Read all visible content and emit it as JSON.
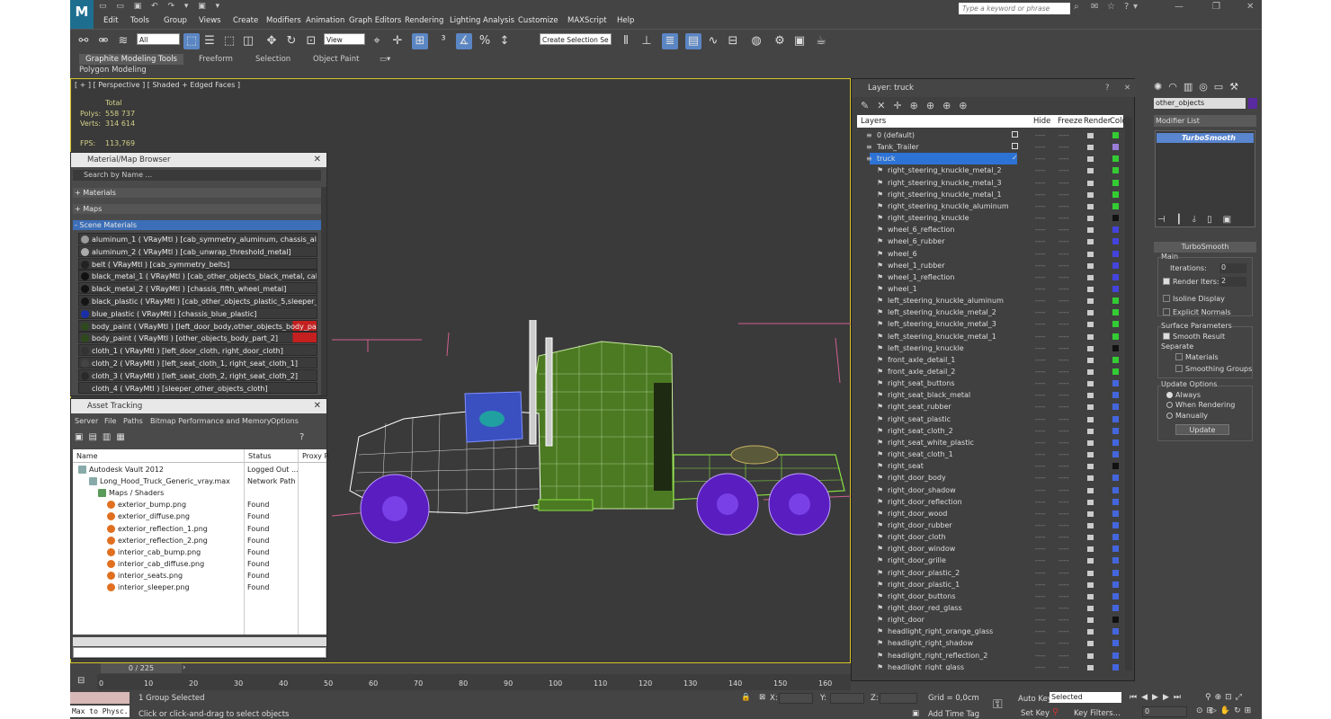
{
  "app": {
    "logo": "M",
    "menus": [
      "Edit",
      "Tools",
      "Group",
      "Views",
      "Create",
      "Modifiers",
      "Animation",
      "Graph Editors",
      "Rendering",
      "Lighting Analysis",
      "Customize",
      "MAXScript",
      "Help"
    ],
    "search_placeholder": "Type a keyword or phrase"
  },
  "toolbar": {
    "filter": "All",
    "refcoord": "View",
    "selset": "Create Selection Se"
  },
  "ribbon": {
    "tabs": [
      "Graphite Modeling Tools",
      "Freeform",
      "Selection",
      "Object Paint"
    ],
    "sub": "Polygon Modeling"
  },
  "viewport": {
    "label": "[ + ] [ Perspective ] [ Shaded + Edged Faces ]",
    "total_label": "Total",
    "polys_label": "Polys:",
    "polys": "558 737",
    "verts_label": "Verts:",
    "verts": "314 614",
    "fps_label": "FPS:",
    "fps": "113,769"
  },
  "material_browser": {
    "title": "Material/Map Browser",
    "search": "Search by Name ...",
    "sections": [
      "+ Materials",
      "+ Maps",
      "- Scene Materials"
    ],
    "items": [
      {
        "label": "aluminum_1  ( VRayMtl ) [cab_symmetry_aluminum, chassis_alumin...",
        "color": "#9a9a9a"
      },
      {
        "label": "aluminum_2  ( VRayMtl ) [cab_unwrap_threshold_metal]",
        "color": "#aaaaaa"
      },
      {
        "label": "belt  ( VRayMtl ) [cab_symmetry_belts]",
        "color": "#222222"
      },
      {
        "label": "black_metal_1  ( VRayMtl ) [cab_other_objects_black_metal, cab_sy...",
        "color": "#111111"
      },
      {
        "label": "black_metal_2  ( VRayMtl ) [chassis_fifth_wheel_metal]",
        "color": "#111111"
      },
      {
        "label": "black_plastic  ( VRayMtl ) [cab_other_objects_plastic_5,sleeper_oth...",
        "color": "#151515"
      },
      {
        "label": "blue_plastic  ( VRayMtl ) [chassis_blue_plastic]",
        "color": "#1a2ea8"
      },
      {
        "label": "body_paint  ( VRayMtl ) [left_door_body,other_objects_body_part_1...",
        "color": "#2e4a1c"
      },
      {
        "label": "body_paint  ( VRayMtl ) [other_objects_body_part_2]",
        "color": "#2e4a1c"
      },
      {
        "label": "cloth_1  ( VRayMtl ) [left_door_cloth, right_door_cloth]",
        "color": "#333333"
      },
      {
        "label": "cloth_2  ( VRayMtl ) [left_seat_cloth_1, right_seat_cloth_1]",
        "color": "#444444"
      },
      {
        "label": "cloth_3  ( VRayMtl ) [left_seat_cloth_2, right_seat_cloth_2]",
        "color": "#2a2a2a"
      },
      {
        "label": "cloth_4  ( VRayMtl ) [sleeper_other_objects_cloth]",
        "color": "#3a3a3a"
      }
    ]
  },
  "asset_tracking": {
    "title": "Asset Tracking",
    "menus": [
      "Server",
      "File",
      "Paths",
      "Bitmap Performance and Memory",
      "Options"
    ],
    "headers": [
      "Name",
      "Status",
      "Proxy R"
    ],
    "rows": [
      {
        "name": "Autodesk Vault 2012",
        "status": "Logged Out ..."
      },
      {
        "name": "Long_Hood_Truck_Generic_vray.max",
        "status": "Network Path"
      },
      {
        "name": "Maps / Shaders",
        "status": ""
      },
      {
        "name": "exterior_bump.png",
        "status": "Found"
      },
      {
        "name": "exterior_diffuse.png",
        "status": "Found"
      },
      {
        "name": "exterior_reflection_1.png",
        "status": "Found"
      },
      {
        "name": "exterior_reflection_2.png",
        "status": "Found"
      },
      {
        "name": "interior_cab_bump.png",
        "status": "Found"
      },
      {
        "name": "interior_cab_diffuse.png",
        "status": "Found"
      },
      {
        "name": "interior_seats.png",
        "status": "Found"
      },
      {
        "name": "interior_sleeper.png",
        "status": "Found"
      }
    ]
  },
  "layer_dialog": {
    "title": "Layer: truck",
    "headers": [
      "Layers",
      "Hide",
      "Freeze",
      "Render",
      "Color"
    ],
    "layers": [
      {
        "name": "0 (default)",
        "color": "#33cc33",
        "top": true
      },
      {
        "name": "Tank_Trailer",
        "color": "#9b7dd8",
        "top": true
      },
      {
        "name": "truck",
        "color": "#33cc33",
        "top": true,
        "selected": true
      },
      {
        "name": "right_steering_knuckle_metal_2",
        "color": "#33cc33"
      },
      {
        "name": "right_steering_knuckle_metal_3",
        "color": "#33cc33"
      },
      {
        "name": "right_steering_knuckle_metal_1",
        "color": "#33cc33"
      },
      {
        "name": "right_steering_knuckle_aluminum",
        "color": "#33cc33"
      },
      {
        "name": "right_steering_knuckle",
        "color": "#111111"
      },
      {
        "name": "wheel_6_reflection",
        "color": "#4444dd"
      },
      {
        "name": "wheel_6_rubber",
        "color": "#4444dd"
      },
      {
        "name": "wheel_6",
        "color": "#4444dd"
      },
      {
        "name": "wheel_1_rubber",
        "color": "#4444dd"
      },
      {
        "name": "wheel_1_reflection",
        "color": "#4444dd"
      },
      {
        "name": "wheel_1",
        "color": "#4444dd"
      },
      {
        "name": "left_steering_knuckle_aluminum",
        "color": "#33cc33"
      },
      {
        "name": "left_steering_knuckle_metal_2",
        "color": "#33cc33"
      },
      {
        "name": "left_steering_knuckle_metal_3",
        "color": "#33cc33"
      },
      {
        "name": "left_steering_knuckle_metal_1",
        "color": "#33cc33"
      },
      {
        "name": "left_steering_knuckle",
        "color": "#111111"
      },
      {
        "name": "front_axle_detail_1",
        "color": "#33cc33"
      },
      {
        "name": "front_axle_detail_2",
        "color": "#33cc33"
      },
      {
        "name": "right_seat_buttons",
        "color": "#4466dd"
      },
      {
        "name": "right_seat_black_metal",
        "color": "#4466dd"
      },
      {
        "name": "right_seat_rubber",
        "color": "#4466dd"
      },
      {
        "name": "right_seat_plastic",
        "color": "#4466dd"
      },
      {
        "name": "right_seat_cloth_2",
        "color": "#4466dd"
      },
      {
        "name": "right_seat_white_plastic",
        "color": "#4466dd"
      },
      {
        "name": "right_seat_cloth_1",
        "color": "#4466dd"
      },
      {
        "name": "right_seat",
        "color": "#111111"
      },
      {
        "name": "right_door_body",
        "color": "#4466dd"
      },
      {
        "name": "right_door_shadow",
        "color": "#4466dd"
      },
      {
        "name": "right_door_reflection",
        "color": "#4466dd"
      },
      {
        "name": "right_door_wood",
        "color": "#4466dd"
      },
      {
        "name": "right_door_rubber",
        "color": "#4466dd"
      },
      {
        "name": "right_door_cloth",
        "color": "#4466dd"
      },
      {
        "name": "right_door_window",
        "color": "#4466dd"
      },
      {
        "name": "right_door_grille",
        "color": "#4466dd"
      },
      {
        "name": "right_door_plastic_2",
        "color": "#4466dd"
      },
      {
        "name": "right_door_plastic_1",
        "color": "#4466dd"
      },
      {
        "name": "right_door_buttons",
        "color": "#4466dd"
      },
      {
        "name": "right_door_red_glass",
        "color": "#4466dd"
      },
      {
        "name": "right_door",
        "color": "#111111"
      },
      {
        "name": "headlight_right_orange_glass",
        "color": "#4466dd"
      },
      {
        "name": "headlight_right_shadow",
        "color": "#4466dd"
      },
      {
        "name": "headlight_right_reflection_2",
        "color": "#4466dd"
      },
      {
        "name": "headlight_right_glass",
        "color": "#4466dd"
      }
    ]
  },
  "command_panel": {
    "object_name": "other_objects",
    "modifier_list": "Modifier List",
    "stack_item": "TurboSmooth",
    "rollout": "TurboSmooth",
    "main": "Main",
    "iterations_label": "Iterations:",
    "iterations": "0",
    "render_iters_label": "Render Iters:",
    "render_iters": "2",
    "isoline": "Isoline Display",
    "explicit_normals": "Explicit Normals",
    "surface_params": "Surface Parameters",
    "smooth_result": "Smooth Result",
    "separate": "Separate",
    "materials": "Materials",
    "smoothing_groups": "Smoothing Groups",
    "update_options": "Update Options",
    "always": "Always",
    "when_rendering": "When Rendering",
    "manually": "Manually",
    "update": "Update"
  },
  "timeline": {
    "frame": "0 / 225",
    "ticks": [
      "0",
      "10",
      "20",
      "30",
      "40",
      "50",
      "60",
      "70",
      "80",
      "90",
      "100",
      "110",
      "120",
      "130",
      "140",
      "150",
      "160"
    ]
  },
  "status": {
    "selected": "1 Group Selected",
    "prompt": "Click or click-and-drag to select objects",
    "maxscript": "Max to Physc.",
    "x": "X:",
    "y": "Y:",
    "z": "Z:",
    "grid": "Grid = 0,0cm",
    "add_time_tag": "Add Time Tag",
    "auto_key": "Auto Key",
    "set_key": "Set Key",
    "key_mode": "Selected",
    "key_filters": "Key Filters...",
    "frame": "0"
  }
}
